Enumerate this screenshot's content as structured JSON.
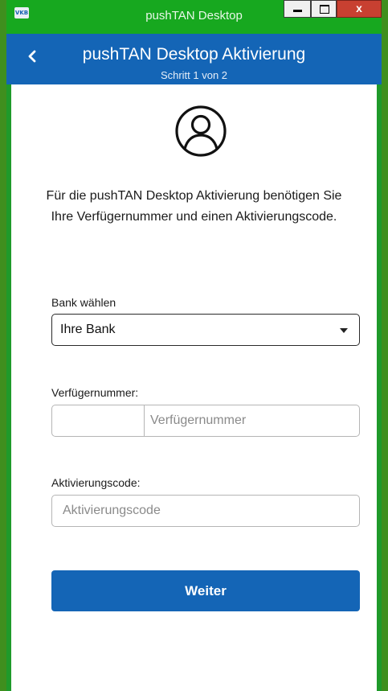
{
  "window": {
    "title": "pushTAN Desktop",
    "app_icon_text": "VKB",
    "close_glyph": "x"
  },
  "header": {
    "back_glyph": "‹",
    "title": "pushTAN Desktop Aktivierung",
    "step": "Schritt 1 von 2"
  },
  "main": {
    "avatar_icon": "user-circle-icon",
    "intro": "Für die pushTAN Desktop Aktivierung benötigen Sie Ihre Verfügernummer und einen Aktivierungscode.",
    "bank": {
      "label": "Bank wählen",
      "selected": "Ihre Bank"
    },
    "verfuegernummer": {
      "label": "Verfügernummer:",
      "prefix_value": "",
      "placeholder": "Verfügernummer"
    },
    "aktivierungscode": {
      "label": "Aktivierungscode:",
      "placeholder": "Aktivierungscode"
    },
    "submit_label": "Weiter"
  },
  "colors": {
    "accent": "#1465b6",
    "titlebar": "#17a81f",
    "close_button": "#c84031"
  }
}
